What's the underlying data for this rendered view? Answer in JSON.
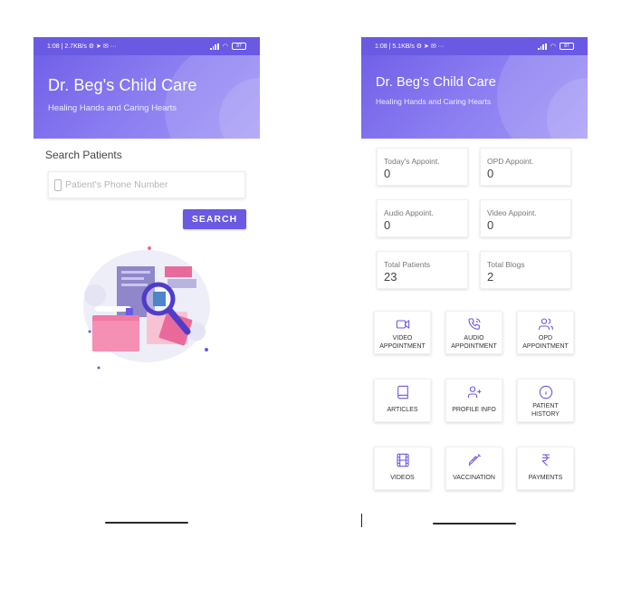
{
  "left_screen": {
    "status_bar": {
      "time": "1:08",
      "speed": "2.7KB/s",
      "battery": "87"
    },
    "header": {
      "title": "Dr. Beg's Child Care",
      "subtitle": "Healing Hands and Caring Hearts"
    },
    "search": {
      "label": "Search Patients",
      "placeholder": "Patient's Phone Number",
      "button_label": "SEARCH"
    },
    "illustration_icon": "search-documents-illustration"
  },
  "right_screen": {
    "status_bar": {
      "time": "1:08",
      "speed": "5.1KB/s",
      "battery": "87"
    },
    "header": {
      "title": "Dr. Beg's Child Care",
      "subtitle": "Healing Hands and Caring Hearts"
    },
    "stats": [
      {
        "label": "Today's Appoint.",
        "value": "0"
      },
      {
        "label": "OPD Appoint.",
        "value": "0"
      },
      {
        "label": "Audio Appoint.",
        "value": "0"
      },
      {
        "label": "Video Appoint.",
        "value": "0"
      },
      {
        "label": "Total Patients",
        "value": "23"
      },
      {
        "label": "Total Blogs",
        "value": "2"
      }
    ],
    "menu": [
      {
        "label": "Video Appointment",
        "icon": "video-camera-icon"
      },
      {
        "label": "Audio Appointment",
        "icon": "phone-call-icon"
      },
      {
        "label": "OPD Appointment",
        "icon": "users-icon"
      },
      {
        "label": "Articles",
        "icon": "book-icon"
      },
      {
        "label": "Profile Info",
        "icon": "user-plus-icon"
      },
      {
        "label": "Patient History",
        "icon": "info-icon"
      },
      {
        "label": "Videos",
        "icon": "film-icon"
      },
      {
        "label": "Vaccination",
        "icon": "syringe-icon"
      },
      {
        "label": "Payments",
        "icon": "rupee-icon"
      }
    ]
  },
  "colors": {
    "primary": "#6a59e2",
    "header_light": "#a195f5",
    "icon": "#6a59e2"
  }
}
